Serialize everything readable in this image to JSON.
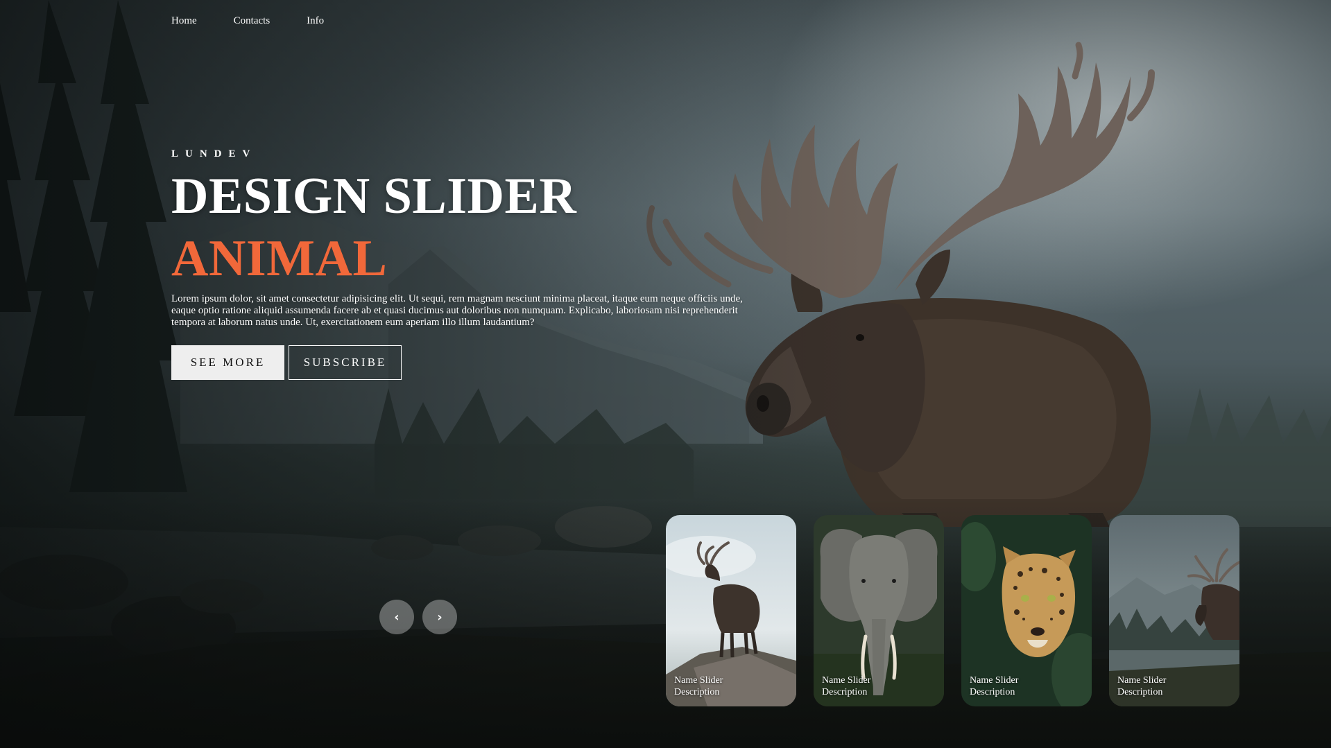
{
  "nav": {
    "items": [
      "Home",
      "Contacts",
      "Info"
    ]
  },
  "hero": {
    "author": "LUNDEV",
    "title": "DESIGN SLIDER",
    "topic": "ANIMAL",
    "description": "Lorem ipsum dolor, sit amet consectetur adipisicing elit. Ut sequi, rem magnam nesciunt minima placeat, itaque eum neque officiis unde, eaque optio ratione aliquid assumenda facere ab et quasi ducimus aut doloribus non numquam. Explicabo, laboriosam nisi reprehenderit tempora at laborum natus unde. Ut, exercitationem eum aperiam illo illum laudantium?",
    "see_more_label": "SEE MORE",
    "subscribe_label": "SUBSCRIBE"
  },
  "arrows": {
    "prev_label": "‹",
    "next_label": "›"
  },
  "thumbnails": [
    {
      "name": "Name Slider",
      "description": "Description",
      "image": "moose-on-rock"
    },
    {
      "name": "Name Slider",
      "description": "Description",
      "image": "elephant"
    },
    {
      "name": "Name Slider",
      "description": "Description",
      "image": "leopard"
    },
    {
      "name": "Name Slider",
      "description": "Description",
      "image": "moose-by-lake"
    }
  ],
  "colors": {
    "accent": "#f1683a",
    "button_light": "#eeeeee",
    "arrow_bg": "rgba(238,238,238,0.35)"
  }
}
